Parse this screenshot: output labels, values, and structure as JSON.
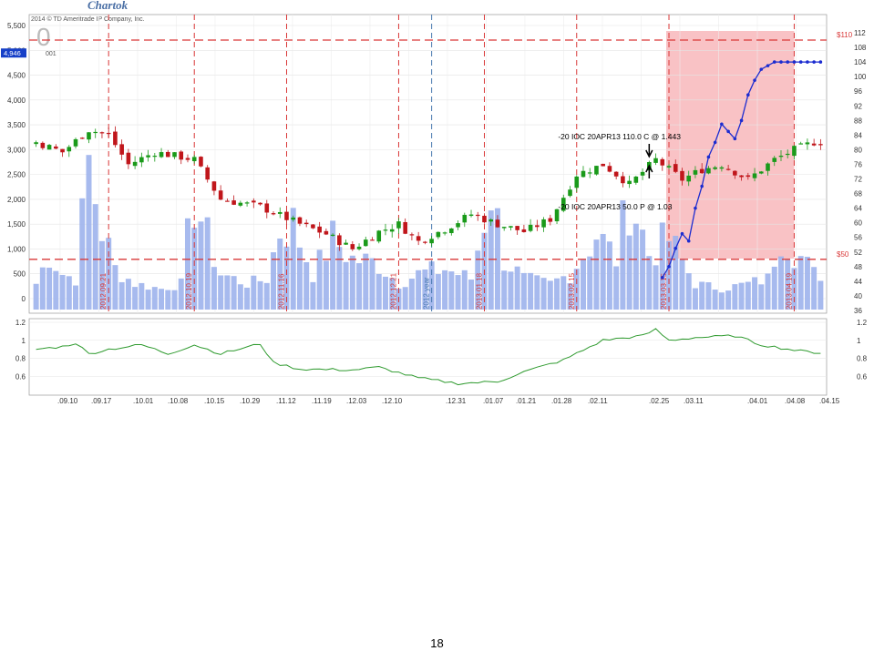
{
  "brand": "Chartok",
  "copyright": "2014 © TD Ameritrade IP Company, Inc.",
  "logo_small": "001",
  "logo_digit": "0",
  "page_number": "18",
  "colors": {
    "up": "#1a9a1a",
    "down": "#c0161b",
    "volume": "#9db3ec",
    "shade": "#f9c2c5",
    "dashed": "#d93838",
    "blue": "#1c2cd0",
    "lower": "#2e9a2e",
    "price_tag": "#1740c8"
  },
  "chart_data": {
    "type": "candlestick",
    "left_axis": {
      "ticks": [
        "5,500",
        "5,000",
        "4,500",
        "4,000",
        "3,500",
        "3,000",
        "2,500",
        "2,000",
        "1,500",
        "1,000",
        "500",
        "0"
      ],
      "values": [
        5500,
        5000,
        4500,
        4000,
        3500,
        3000,
        2500,
        2000,
        1500,
        1000,
        500,
        0
      ]
    },
    "right_axis": {
      "ticks": [
        "112",
        "108",
        "104",
        "100",
        "96",
        "92",
        "88",
        "84",
        "80",
        "76",
        "72",
        "68",
        "64",
        "60",
        "56",
        "52",
        "48",
        "44",
        "40",
        "36"
      ],
      "values": [
        112,
        108,
        104,
        100,
        96,
        92,
        88,
        84,
        80,
        76,
        72,
        68,
        64,
        60,
        56,
        52,
        48,
        44,
        40,
        36
      ]
    },
    "current_price_tag": "4,946",
    "x_ticks": [
      ".09.10",
      ".09.17",
      ".10.01",
      ".10.08",
      ".10.15",
      ".10.29",
      ".11.12",
      ".11.19",
      ".12.03",
      ".12.10",
      ".12.31",
      ".01.07",
      ".01.21",
      ".01.28",
      ".02.11",
      ".02.25",
      ".03.11",
      ".04.01",
      ".04.08",
      ".04.15"
    ],
    "vertical_markers": [
      {
        "label": "2012.09.21",
        "index": 11,
        "style": "red"
      },
      {
        "label": "2012.10.19",
        "index": 24,
        "style": "red"
      },
      {
        "label": "2012.11.16",
        "index": 38,
        "style": "red"
      },
      {
        "label": "2012.12.21",
        "index": 55,
        "style": "red"
      },
      {
        "label": "2012 year",
        "index": 60,
        "style": "blue"
      },
      {
        "label": "2013.01.18",
        "index": 68,
        "style": "red"
      },
      {
        "label": "2013.02.15",
        "index": 82,
        "style": "red"
      },
      {
        "label": "2013.03.15",
        "index": 96,
        "style": "red"
      },
      {
        "label": "2013.04.19",
        "index": 115,
        "style": "red"
      }
    ],
    "horizontal_levels": [
      {
        "label": "$110",
        "value": 110
      },
      {
        "label": "$50",
        "value": 50
      }
    ],
    "shaded_region": {
      "from_index": 96,
      "to_index": 115
    },
    "annotations": [
      {
        "text": "-20 IOC 20APR13 110.0 C @ 1.443",
        "index": 93,
        "arrow": "down"
      },
      {
        "text": "-20 IOC 20APR13 50.0 P @ 1.03",
        "index": 93,
        "arrow": "up"
      }
    ],
    "close_points": [
      {
        "i": 0,
        "c": 3150
      },
      {
        "i": 4,
        "c": 2950
      },
      {
        "i": 8,
        "c": 3400
      },
      {
        "i": 11,
        "c": 3300
      },
      {
        "i": 14,
        "c": 2700
      },
      {
        "i": 18,
        "c": 2950
      },
      {
        "i": 24,
        "c": 2800
      },
      {
        "i": 28,
        "c": 2000
      },
      {
        "i": 34,
        "c": 1850
      },
      {
        "i": 40,
        "c": 1500
      },
      {
        "i": 44,
        "c": 1300
      },
      {
        "i": 48,
        "c": 1000
      },
      {
        "i": 52,
        "c": 1350
      },
      {
        "i": 55,
        "c": 1500
      },
      {
        "i": 58,
        "c": 1150
      },
      {
        "i": 62,
        "c": 1400
      },
      {
        "i": 66,
        "c": 1700
      },
      {
        "i": 70,
        "c": 1500
      },
      {
        "i": 74,
        "c": 1350
      },
      {
        "i": 78,
        "c": 1600
      },
      {
        "i": 82,
        "c": 2500
      },
      {
        "i": 86,
        "c": 2700
      },
      {
        "i": 90,
        "c": 2300
      },
      {
        "i": 94,
        "c": 2800
      },
      {
        "i": 98,
        "c": 2400
      },
      {
        "i": 101,
        "c": 2600
      },
      {
        "i": 104,
        "c": 2700
      },
      {
        "i": 108,
        "c": 2400
      },
      {
        "i": 112,
        "c": 2800
      },
      {
        "i": 115,
        "c": 3000
      },
      {
        "i": 118,
        "c": 3150
      }
    ],
    "volume_points": [
      {
        "i": 0,
        "v": 300
      },
      {
        "i": 2,
        "v": 900
      },
      {
        "i": 4,
        "v": 500
      },
      {
        "i": 6,
        "v": 400
      },
      {
        "i": 8,
        "v": 2700
      },
      {
        "i": 10,
        "v": 1400
      },
      {
        "i": 12,
        "v": 600
      },
      {
        "i": 15,
        "v": 300
      },
      {
        "i": 19,
        "v": 200
      },
      {
        "i": 22,
        "v": 300
      },
      {
        "i": 24,
        "v": 2050
      },
      {
        "i": 26,
        "v": 1200
      },
      {
        "i": 28,
        "v": 500
      },
      {
        "i": 32,
        "v": 300
      },
      {
        "i": 35,
        "v": 400
      },
      {
        "i": 37,
        "v": 1400
      },
      {
        "i": 39,
        "v": 1500
      },
      {
        "i": 42,
        "v": 500
      },
      {
        "i": 45,
        "v": 1200
      },
      {
        "i": 48,
        "v": 800
      },
      {
        "i": 52,
        "v": 700
      },
      {
        "i": 55,
        "v": 300
      },
      {
        "i": 58,
        "v": 500
      },
      {
        "i": 62,
        "v": 600
      },
      {
        "i": 66,
        "v": 400
      },
      {
        "i": 69,
        "v": 2250
      },
      {
        "i": 71,
        "v": 800
      },
      {
        "i": 74,
        "v": 400
      },
      {
        "i": 78,
        "v": 300
      },
      {
        "i": 81,
        "v": 500
      },
      {
        "i": 85,
        "v": 1300
      },
      {
        "i": 88,
        "v": 800
      },
      {
        "i": 90,
        "v": 2100
      },
      {
        "i": 93,
        "v": 900
      },
      {
        "i": 96,
        "v": 1200
      },
      {
        "i": 100,
        "v": 300
      },
      {
        "i": 104,
        "v": 200
      },
      {
        "i": 108,
        "v": 300
      },
      {
        "i": 111,
        "v": 400
      },
      {
        "i": 113,
        "v": 1350
      },
      {
        "i": 115,
        "v": 1000
      },
      {
        "i": 118,
        "v": 500
      }
    ],
    "blue_points": [
      {
        "i": 95,
        "y": 45
      },
      {
        "i": 96,
        "y": 48
      },
      {
        "i": 97,
        "y": 53
      },
      {
        "i": 98,
        "y": 57
      },
      {
        "i": 99,
        "y": 55
      },
      {
        "i": 100,
        "y": 64
      },
      {
        "i": 101,
        "y": 70
      },
      {
        "i": 102,
        "y": 78
      },
      {
        "i": 103,
        "y": 82
      },
      {
        "i": 104,
        "y": 87
      },
      {
        "i": 105,
        "y": 85
      },
      {
        "i": 106,
        "y": 83
      },
      {
        "i": 107,
        "y": 88
      },
      {
        "i": 108,
        "y": 95
      },
      {
        "i": 109,
        "y": 99
      },
      {
        "i": 110,
        "y": 102
      },
      {
        "i": 111,
        "y": 103
      },
      {
        "i": 112,
        "y": 104
      },
      {
        "i": 116,
        "y": 104
      },
      {
        "i": 119,
        "y": 104
      }
    ],
    "lower_panel": {
      "ticks": [
        "1.2",
        "1",
        "0.8",
        "0.6"
      ],
      "values": [
        1.2,
        1.0,
        0.8,
        0.6
      ],
      "points": [
        {
          "i": 0,
          "v": 0.9
        },
        {
          "i": 4,
          "v": 0.93
        },
        {
          "i": 6,
          "v": 0.97
        },
        {
          "i": 8,
          "v": 0.85
        },
        {
          "i": 11,
          "v": 0.9
        },
        {
          "i": 16,
          "v": 0.95
        },
        {
          "i": 20,
          "v": 0.85
        },
        {
          "i": 24,
          "v": 0.95
        },
        {
          "i": 28,
          "v": 0.85
        },
        {
          "i": 34,
          "v": 0.96
        },
        {
          "i": 36,
          "v": 0.75
        },
        {
          "i": 40,
          "v": 0.68
        },
        {
          "i": 48,
          "v": 0.67
        },
        {
          "i": 52,
          "v": 0.7
        },
        {
          "i": 58,
          "v": 0.58
        },
        {
          "i": 64,
          "v": 0.52
        },
        {
          "i": 70,
          "v": 0.54
        },
        {
          "i": 74,
          "v": 0.65
        },
        {
          "i": 80,
          "v": 0.78
        },
        {
          "i": 86,
          "v": 1.0
        },
        {
          "i": 92,
          "v": 1.05
        },
        {
          "i": 94,
          "v": 1.12
        },
        {
          "i": 96,
          "v": 1.0
        },
        {
          "i": 100,
          "v": 1.03
        },
        {
          "i": 106,
          "v": 1.05
        },
        {
          "i": 110,
          "v": 0.95
        },
        {
          "i": 116,
          "v": 0.88
        },
        {
          "i": 119,
          "v": 0.86
        }
      ]
    }
  }
}
